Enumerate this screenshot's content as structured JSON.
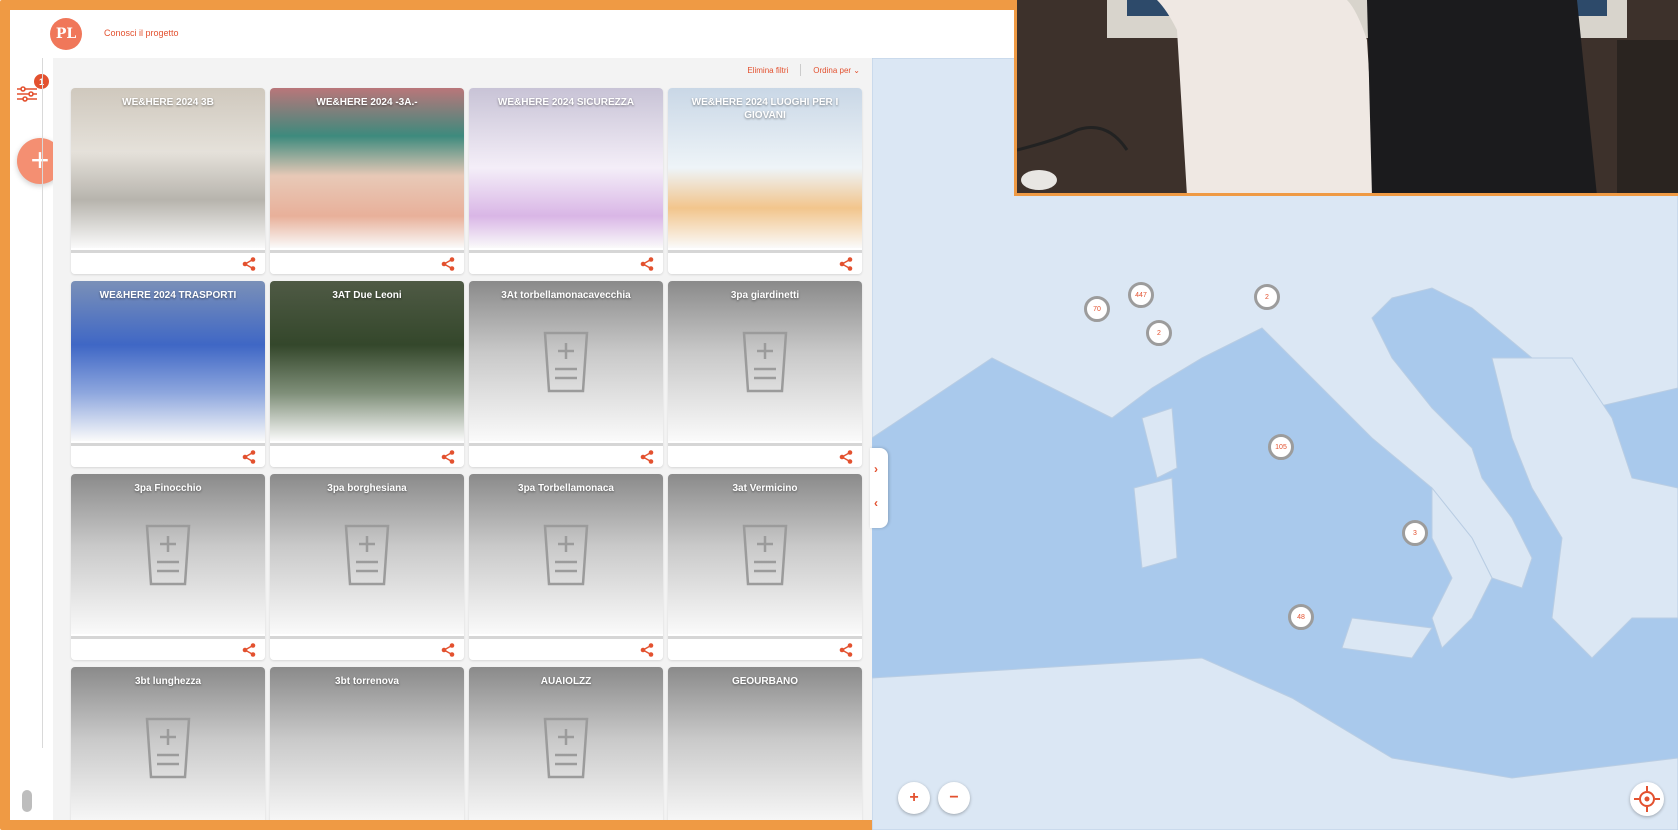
{
  "header": {
    "logo_text": "PL",
    "project_link": "Conosci il progetto"
  },
  "sidebar": {
    "filter_badge": "1",
    "add_label": "+"
  },
  "toolbar": {
    "clear_filters": "Elimina filtri",
    "sort_by": "Ordina per"
  },
  "cards": [
    {
      "title": "WE&HERE 2024 3B",
      "image": "classroom-photo"
    },
    {
      "title": "WE&HERE 2024 -3A.-",
      "image": "classroom-illustration"
    },
    {
      "title": "WE&HERE 2024 SICUREZZA",
      "image": "people-illustration"
    },
    {
      "title": "WE&HERE 2024 LUOGHI PER I GIOVANI",
      "image": "youth-illustration"
    },
    {
      "title": "WE&HERE 2024 TRASPORTI",
      "image": "transport-illustration"
    },
    {
      "title": "3AT Due Leoni",
      "image": "trees-photo"
    },
    {
      "title": "3At torbellamonacavecchia",
      "image": "placeholder"
    },
    {
      "title": "3pa giardinetti",
      "image": "placeholder"
    },
    {
      "title": "3pa Finocchio",
      "image": "placeholder"
    },
    {
      "title": "3pa borghesiana",
      "image": "placeholder"
    },
    {
      "title": "3pa Torbellamonaca",
      "image": "placeholder"
    },
    {
      "title": "3at Vermicino",
      "image": "placeholder"
    },
    {
      "title": "3bt lunghezza",
      "image": "placeholder"
    },
    {
      "title": "3bt torrenova",
      "image": "broken"
    },
    {
      "title": "AUAIOLZZ",
      "image": "placeholder"
    },
    {
      "title": "GEOURBANO",
      "image": "broken"
    }
  ],
  "map": {
    "clusters": [
      "70",
      "447",
      "2",
      "2",
      "105",
      "3",
      "48"
    ],
    "zoom_in": "+",
    "zoom_out": "−"
  },
  "colors": {
    "accent": "#e3512f",
    "frame": "#ef9a44",
    "sea": "#a9c9ec",
    "land": "#dbe7f4"
  }
}
